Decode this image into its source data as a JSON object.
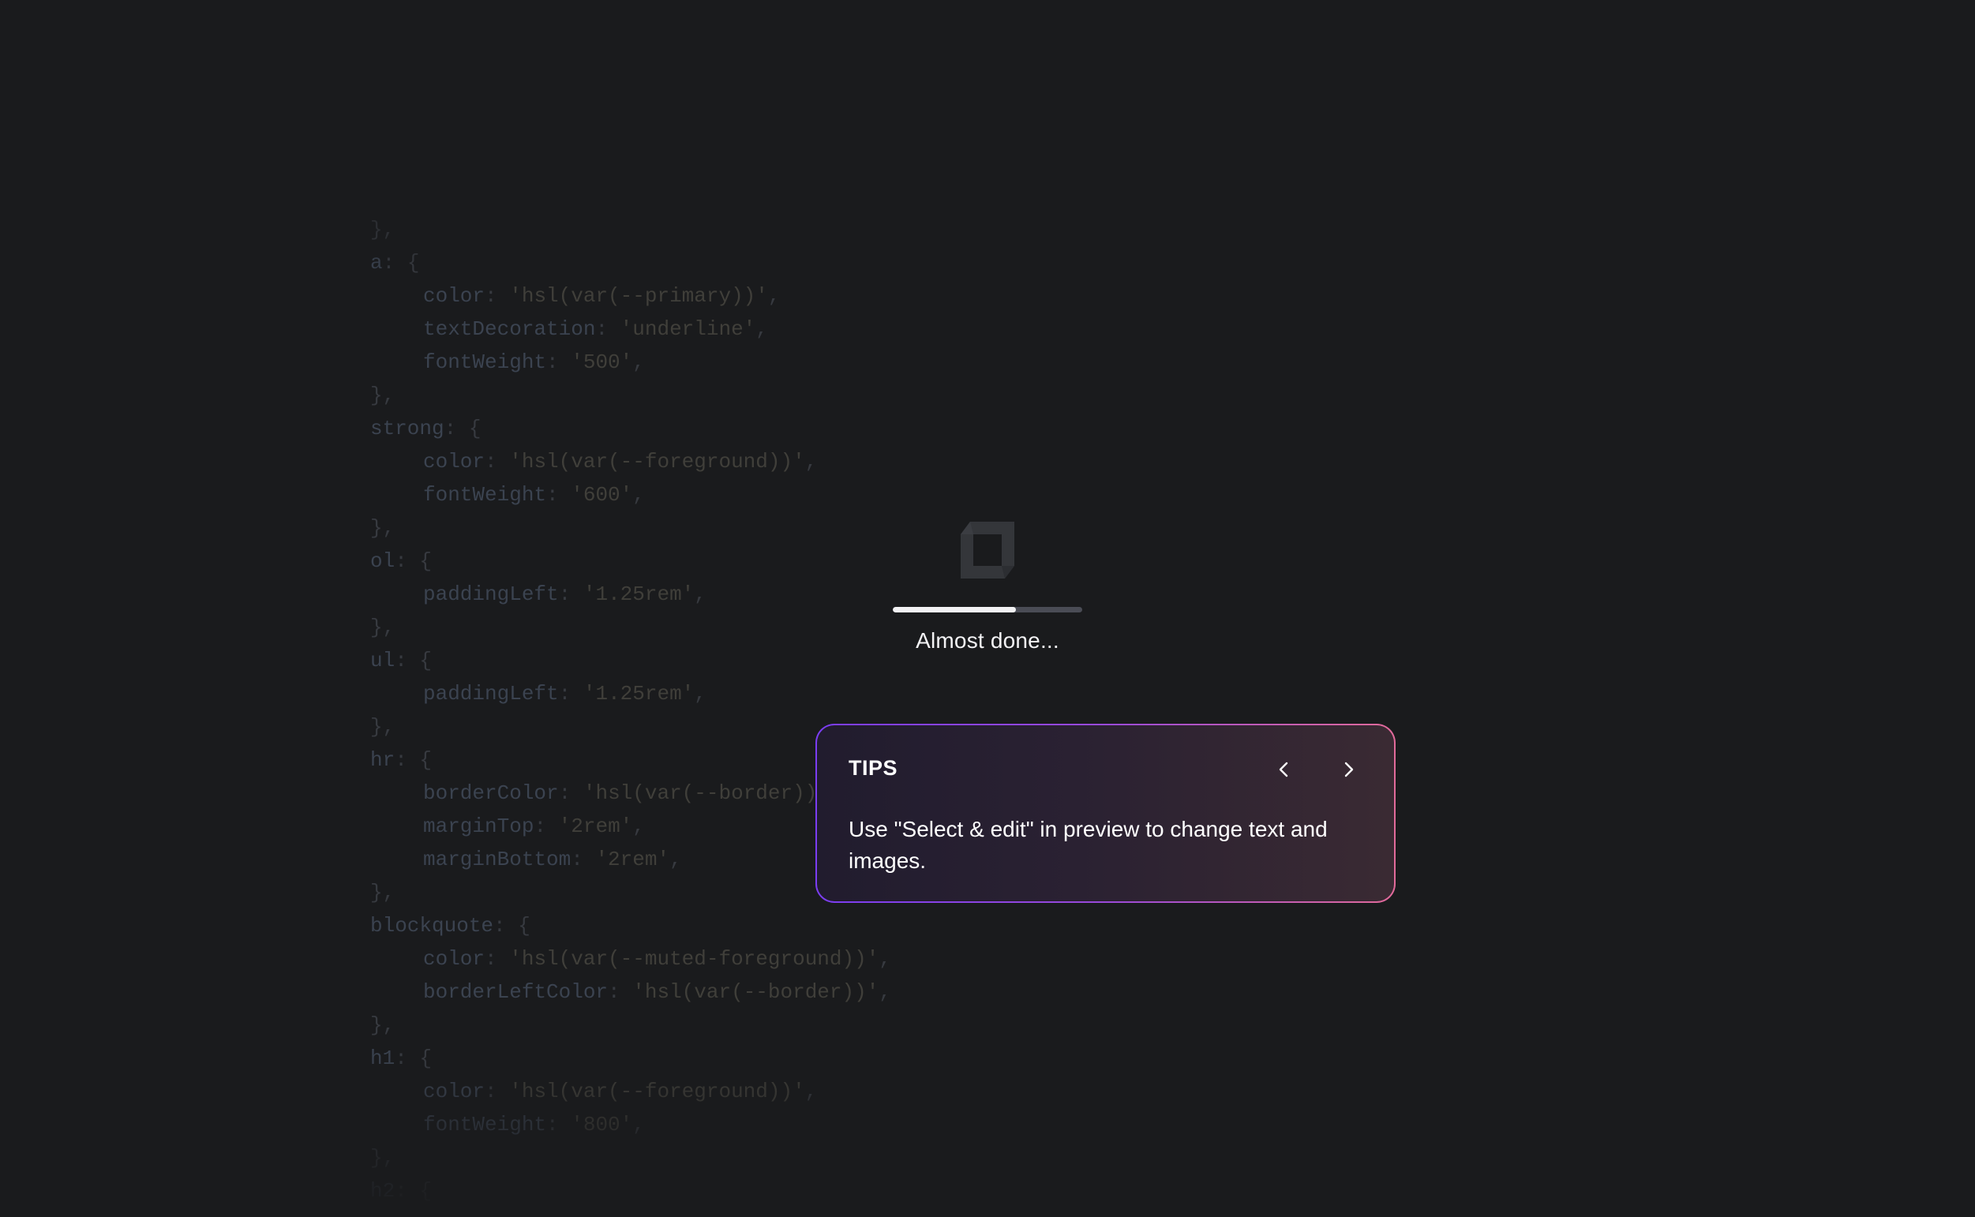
{
  "code_lines": [
    {
      "indent": 0,
      "parts": [
        {
          "t": "},",
          "c": "punc"
        }
      ]
    },
    {
      "indent": 0,
      "parts": [
        {
          "t": "a",
          "c": "key"
        },
        {
          "t": ": {",
          "c": "punc"
        }
      ]
    },
    {
      "indent": 1,
      "parts": [
        {
          "t": "color",
          "c": "key"
        },
        {
          "t": ": ",
          "c": "punc"
        },
        {
          "t": "'hsl(var(--primary))'",
          "c": "str"
        },
        {
          "t": ",",
          "c": "punc"
        }
      ]
    },
    {
      "indent": 1,
      "parts": [
        {
          "t": "textDecoration",
          "c": "key"
        },
        {
          "t": ": ",
          "c": "punc"
        },
        {
          "t": "'underline'",
          "c": "str"
        },
        {
          "t": ",",
          "c": "punc"
        }
      ]
    },
    {
      "indent": 1,
      "parts": [
        {
          "t": "fontWeight",
          "c": "key"
        },
        {
          "t": ": ",
          "c": "punc"
        },
        {
          "t": "'500'",
          "c": "str"
        },
        {
          "t": ",",
          "c": "punc"
        }
      ]
    },
    {
      "indent": 0,
      "parts": [
        {
          "t": "},",
          "c": "punc"
        }
      ]
    },
    {
      "indent": 0,
      "parts": [
        {
          "t": "strong",
          "c": "key"
        },
        {
          "t": ": {",
          "c": "punc"
        }
      ]
    },
    {
      "indent": 1,
      "parts": [
        {
          "t": "color",
          "c": "key"
        },
        {
          "t": ": ",
          "c": "punc"
        },
        {
          "t": "'hsl(var(--foreground))'",
          "c": "str"
        },
        {
          "t": ",",
          "c": "punc"
        }
      ]
    },
    {
      "indent": 1,
      "parts": [
        {
          "t": "fontWeight",
          "c": "key"
        },
        {
          "t": ": ",
          "c": "punc"
        },
        {
          "t": "'600'",
          "c": "str"
        },
        {
          "t": ",",
          "c": "punc"
        }
      ]
    },
    {
      "indent": 0,
      "parts": [
        {
          "t": "},",
          "c": "punc"
        }
      ]
    },
    {
      "indent": 0,
      "parts": [
        {
          "t": "ol",
          "c": "key"
        },
        {
          "t": ": {",
          "c": "punc"
        }
      ]
    },
    {
      "indent": 1,
      "parts": [
        {
          "t": "paddingLeft",
          "c": "key"
        },
        {
          "t": ": ",
          "c": "punc"
        },
        {
          "t": "'1.25rem'",
          "c": "str"
        },
        {
          "t": ",",
          "c": "punc"
        }
      ]
    },
    {
      "indent": 0,
      "parts": [
        {
          "t": "},",
          "c": "punc"
        }
      ]
    },
    {
      "indent": 0,
      "parts": [
        {
          "t": "ul",
          "c": "key"
        },
        {
          "t": ": {",
          "c": "punc"
        }
      ]
    },
    {
      "indent": 1,
      "parts": [
        {
          "t": "paddingLeft",
          "c": "key"
        },
        {
          "t": ": ",
          "c": "punc"
        },
        {
          "t": "'1.25rem'",
          "c": "str"
        },
        {
          "t": ",",
          "c": "punc"
        }
      ]
    },
    {
      "indent": 0,
      "parts": [
        {
          "t": "},",
          "c": "punc"
        }
      ]
    },
    {
      "indent": 0,
      "parts": [
        {
          "t": "hr",
          "c": "key"
        },
        {
          "t": ": {",
          "c": "punc"
        }
      ]
    },
    {
      "indent": 1,
      "parts": [
        {
          "t": "borderColor",
          "c": "key"
        },
        {
          "t": ": ",
          "c": "punc"
        },
        {
          "t": "'hsl(var(--border))'",
          "c": "str"
        },
        {
          "t": ",",
          "c": "punc"
        }
      ]
    },
    {
      "indent": 1,
      "parts": [
        {
          "t": "marginTop",
          "c": "key"
        },
        {
          "t": ": ",
          "c": "punc"
        },
        {
          "t": "'2rem'",
          "c": "str"
        },
        {
          "t": ",",
          "c": "punc"
        }
      ]
    },
    {
      "indent": 1,
      "parts": [
        {
          "t": "marginBottom",
          "c": "key"
        },
        {
          "t": ": ",
          "c": "punc"
        },
        {
          "t": "'2rem'",
          "c": "str"
        },
        {
          "t": ",",
          "c": "punc"
        }
      ]
    },
    {
      "indent": 0,
      "parts": [
        {
          "t": "},",
          "c": "punc"
        }
      ]
    },
    {
      "indent": 0,
      "parts": [
        {
          "t": "blockquote",
          "c": "key"
        },
        {
          "t": ": {",
          "c": "punc"
        }
      ]
    },
    {
      "indent": 1,
      "parts": [
        {
          "t": "color",
          "c": "key"
        },
        {
          "t": ": ",
          "c": "punc"
        },
        {
          "t": "'hsl(var(--muted-foreground))'",
          "c": "str"
        },
        {
          "t": ",",
          "c": "punc"
        }
      ]
    },
    {
      "indent": 1,
      "parts": [
        {
          "t": "borderLeftColor",
          "c": "key"
        },
        {
          "t": ": ",
          "c": "punc"
        },
        {
          "t": "'hsl(var(--border))'",
          "c": "str"
        },
        {
          "t": ",",
          "c": "punc"
        }
      ]
    },
    {
      "indent": 0,
      "parts": [
        {
          "t": "},",
          "c": "punc"
        }
      ]
    },
    {
      "indent": 0,
      "parts": [
        {
          "t": "h1",
          "c": "key"
        },
        {
          "t": ": {",
          "c": "punc"
        }
      ]
    },
    {
      "indent": 1,
      "parts": [
        {
          "t": "color",
          "c": "key"
        },
        {
          "t": ": ",
          "c": "punc"
        },
        {
          "t": "'hsl(var(--foreground))'",
          "c": "str"
        },
        {
          "t": ",",
          "c": "punc"
        }
      ]
    },
    {
      "indent": 1,
      "parts": [
        {
          "t": "fontWeight",
          "c": "key"
        },
        {
          "t": ": ",
          "c": "punc"
        },
        {
          "t": "'800'",
          "c": "str"
        },
        {
          "t": ",",
          "c": "punc"
        }
      ]
    },
    {
      "indent": 0,
      "parts": [
        {
          "t": "},",
          "c": "punc"
        }
      ]
    },
    {
      "indent": 0,
      "parts": [
        {
          "t": "h2",
          "c": "key"
        },
        {
          "t": ": {",
          "c": "punc"
        }
      ]
    }
  ],
  "loader": {
    "logo_icon": "app-logo-icon",
    "progress": 0.65,
    "status": "Almost done..."
  },
  "tips": {
    "title": "TIPS",
    "prev_icon": "chevron-left-icon",
    "next_icon": "chevron-right-icon",
    "text": "Use \"Select & edit\" in preview to change text and images."
  },
  "colors": {
    "background": "#1a1b1d",
    "card_border_start": "#7b3df2",
    "card_border_end": "#e26a9a",
    "progress_fill": "#f2f2f4",
    "progress_track": "#4a4c55"
  }
}
